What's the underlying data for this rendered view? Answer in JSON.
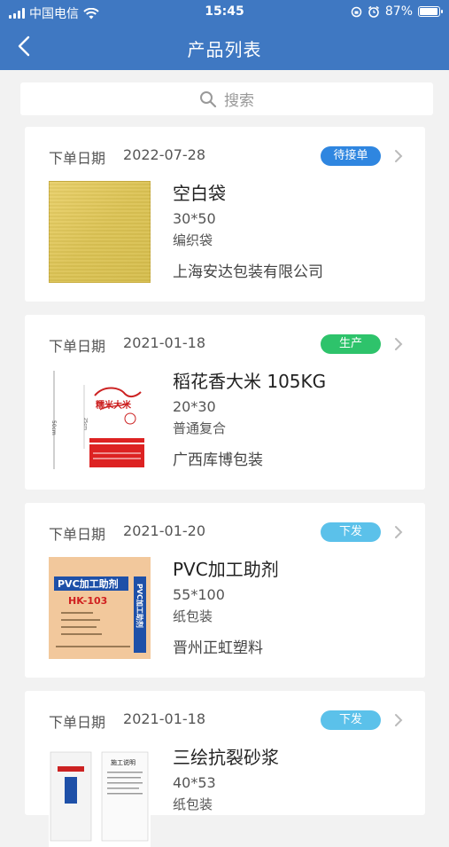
{
  "status_bar": {
    "carrier": "中国电信",
    "time": "15:45",
    "battery": "87%",
    "battery_level": 0.87
  },
  "header": {
    "title": "产品列表"
  },
  "search": {
    "placeholder": "搜索"
  },
  "colors": {
    "header_bg": "#3f78c2",
    "badge_blue": "#2f86e0",
    "badge_green": "#2ec36b",
    "badge_light_blue": "#5bc1ea"
  },
  "orders": [
    {
      "date_label": "下单日期",
      "date": "2022-07-28",
      "status": "待接单",
      "status_color": "#2f86e0",
      "name": "空白袋",
      "size": "30*50",
      "type": "编织袋",
      "company": "上海安达包装有限公司"
    },
    {
      "date_label": "下单日期",
      "date": "2021-01-18",
      "status": "生产",
      "status_color": "#2ec36b",
      "name": "稻花香大米 105KG",
      "size": "20*30",
      "type": "普通复合",
      "company": "广西库博包装",
      "thumb_text": {
        "dim_side": "50cm",
        "dim_inner": "25cm",
        "brand": "糯米大米"
      }
    },
    {
      "date_label": "下单日期",
      "date": "2021-01-20",
      "status": "下发",
      "status_color": "#5bc1ea",
      "name": "PVC加工助剂",
      "size": "55*100",
      "type": "纸包装",
      "company": "晋州正虹塑料",
      "thumb_text": {
        "label": "PVC加工助剂",
        "code": "HK-103",
        "side": "PVC加工助剂"
      }
    },
    {
      "date_label": "下单日期",
      "date": "2021-01-18",
      "status": "下发",
      "status_color": "#5bc1ea",
      "name": "三绘抗裂砂浆",
      "size": "40*53",
      "type": "纸包装",
      "company": "",
      "thumb_text": {
        "notice": "施工说明"
      }
    }
  ]
}
